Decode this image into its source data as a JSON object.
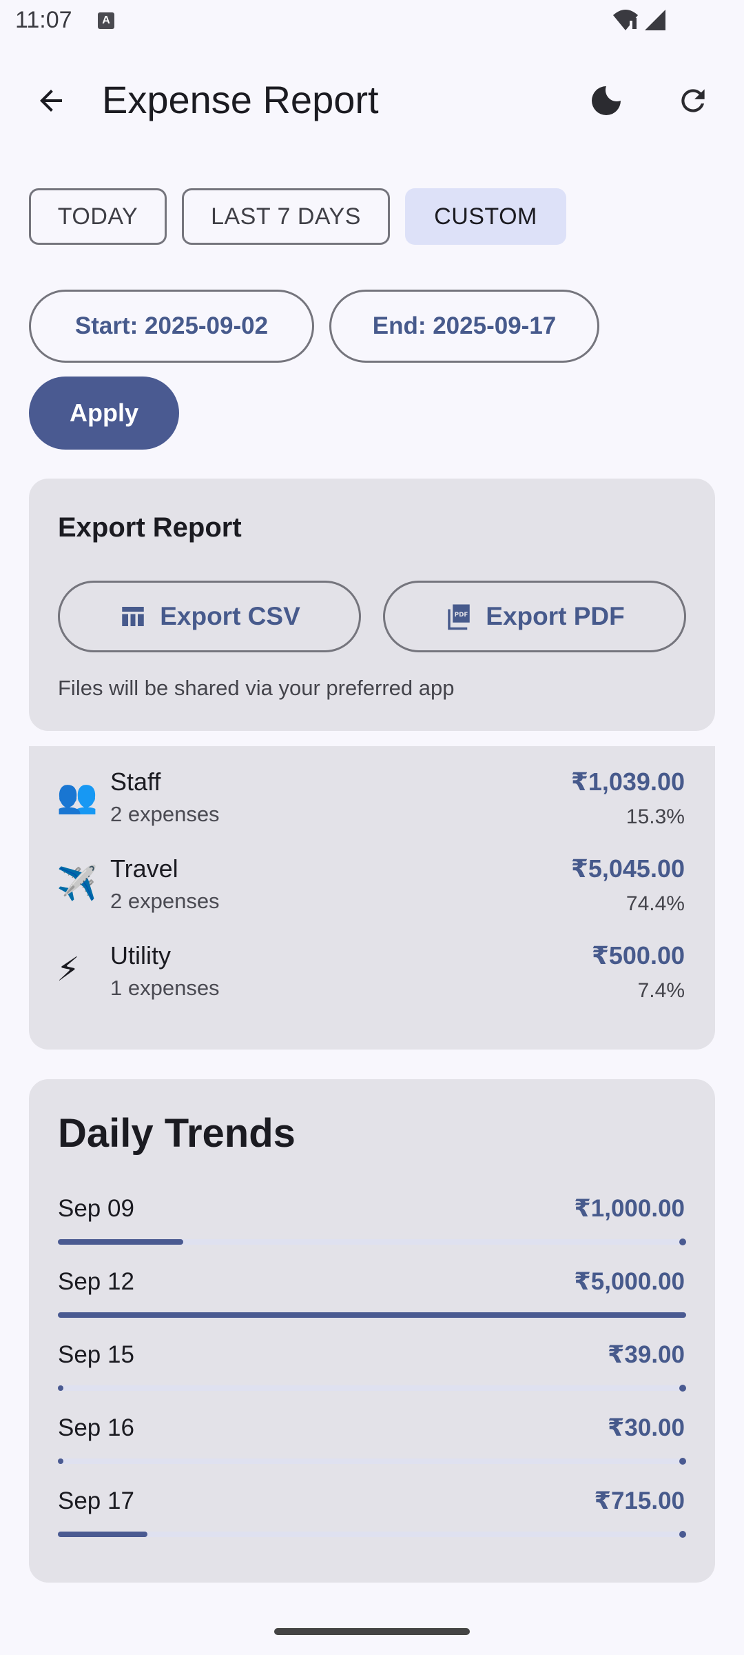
{
  "status_bar": {
    "time": "11:07",
    "notif_letter": "A"
  },
  "app_bar": {
    "title": "Expense Report",
    "back_icon": "arrow-back-icon",
    "theme_icon": "moon-icon",
    "refresh_icon": "refresh-icon"
  },
  "filters": {
    "today": "TODAY",
    "last7": "LAST 7 DAYS",
    "custom": "CUSTOM",
    "selected": "CUSTOM"
  },
  "date_range": {
    "start": "Start: 2025-09-02",
    "end": "End: 2025-09-17",
    "apply": "Apply"
  },
  "export": {
    "title": "Export Report",
    "csv_label": "Export CSV",
    "pdf_label": "Export PDF",
    "note": "Files will be shared via your preferred app"
  },
  "categories": [
    {
      "emoji": "👥",
      "name": "Staff",
      "count": "2 expenses",
      "amount": "₹1,039.00",
      "percent": "15.3%"
    },
    {
      "emoji": "✈️",
      "name": "Travel",
      "count": "2 expenses",
      "amount": "₹5,045.00",
      "percent": "74.4%"
    },
    {
      "emoji": "⚡",
      "name": "Utility",
      "count": "1 expenses",
      "amount": "₹500.00",
      "percent": "7.4%"
    }
  ],
  "daily_trends": {
    "title": "Daily Trends",
    "days": [
      {
        "label": "Sep 09",
        "amount": "₹1,000.00",
        "value": 1000
      },
      {
        "label": "Sep 12",
        "amount": "₹5,000.00",
        "value": 5000
      },
      {
        "label": "Sep 15",
        "amount": "₹39.00",
        "value": 39
      },
      {
        "label": "Sep 16",
        "amount": "₹30.00",
        "value": 30
      },
      {
        "label": "Sep 17",
        "amount": "₹715.00",
        "value": 715
      }
    ],
    "max_value": 5000
  },
  "colors": {
    "accent": "#4a5a91",
    "card": "#e3e2e8",
    "background": "#f8f7fd",
    "selected_chip": "#dde1f8"
  }
}
